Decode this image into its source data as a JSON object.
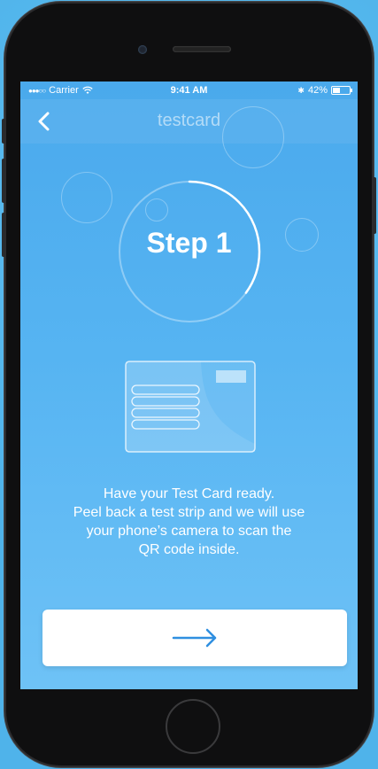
{
  "status_bar": {
    "carrier": "Carrier",
    "time": "9:41 AM",
    "battery": "42%",
    "signal_dots": "●●●○○",
    "bluetooth_glyph": "✱"
  },
  "nav": {
    "title": "testcard",
    "back_icon": "chevron-left-icon"
  },
  "step": {
    "label": "Step 1",
    "progress": 0.35
  },
  "instructions": [
    "Have your Test Card ready.",
    "Peel back a test strip and we will use",
    "your phone’s camera to scan the",
    "QR code inside."
  ],
  "next_button": {
    "icon": "arrow-right-icon"
  },
  "colors": {
    "accent": "#2f8fe0",
    "screen_top": "#4aa9ec",
    "screen_bottom": "#6ec2f6",
    "phone_body": "#0f0f10"
  }
}
